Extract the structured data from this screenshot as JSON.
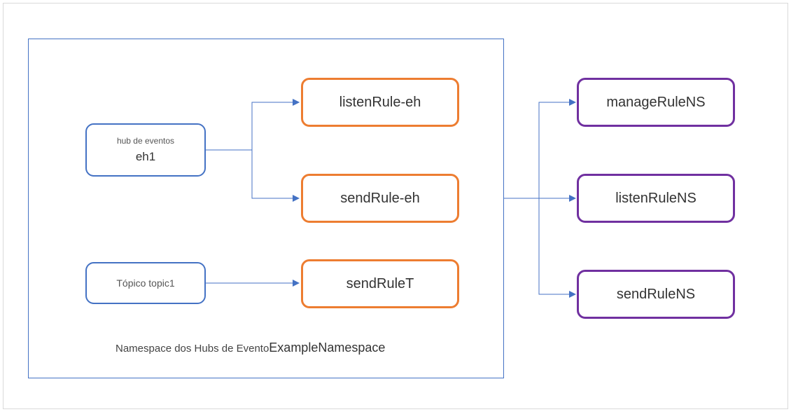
{
  "namespace": {
    "captionPrefix": "Namespace dos Hubs de Evento",
    "captionName": "ExampleNamespace"
  },
  "eventHub": {
    "subLabel": "hub de eventos",
    "name": "eh1",
    "rules": {
      "listen": "listenRule-eh",
      "send": "sendRule-eh"
    }
  },
  "topic": {
    "label": "Tópico topic1",
    "rules": {
      "send": "sendRuleT"
    }
  },
  "nsRules": {
    "manage": "manageRuleNS",
    "listen": "listenRuleNS",
    "send": "sendRuleNS"
  },
  "colors": {
    "blue": "#4472c4",
    "orange": "#ed7d31",
    "purple": "#7030a0"
  }
}
